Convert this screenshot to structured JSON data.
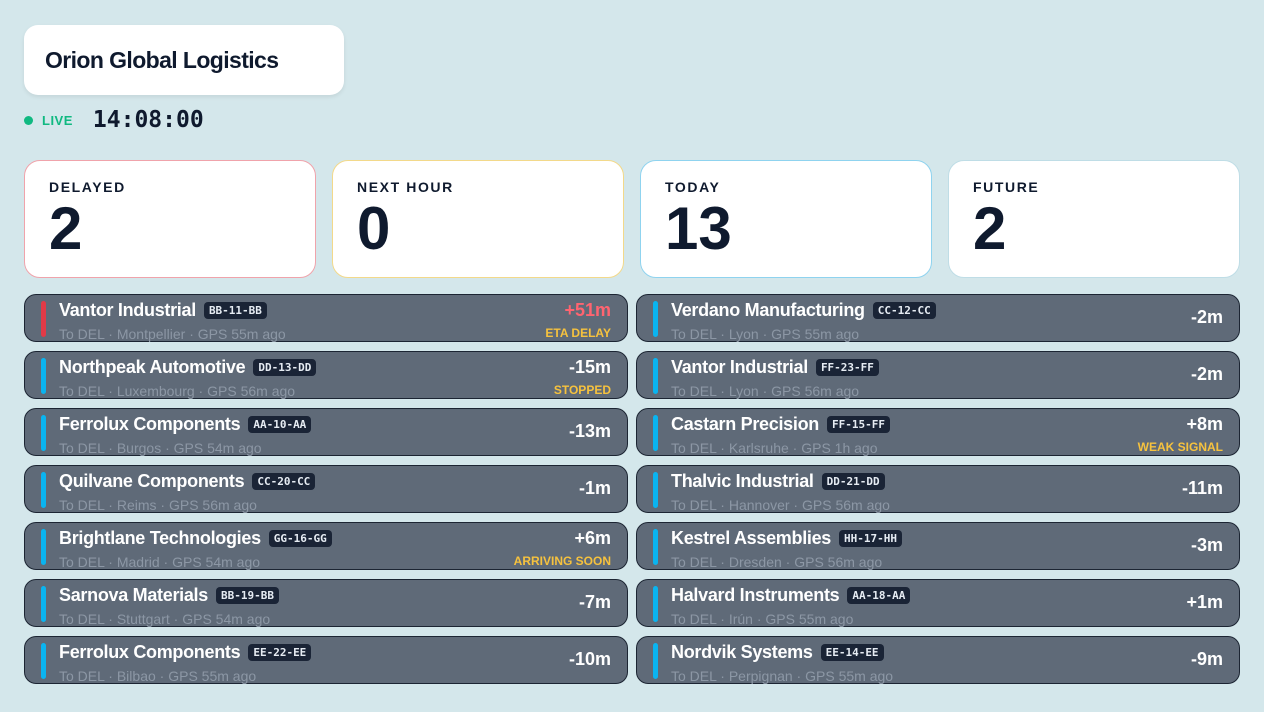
{
  "header": {
    "title": "Orion Global Logistics",
    "live_label": "LIVE",
    "clock": "14:08:00"
  },
  "stats": [
    {
      "label": "DELAYED",
      "value": "2",
      "border_color": "#f0a3ab"
    },
    {
      "label": "NEXT HOUR",
      "value": "0",
      "border_color": "#f3d98a"
    },
    {
      "label": "TODAY",
      "value": "13",
      "border_color": "#8fd3ef"
    },
    {
      "label": "FUTURE",
      "value": "2",
      "border_color": "#bfdde6"
    }
  ],
  "colors": {
    "background": "#d4e7eb",
    "row_bg": "#5f6a78",
    "accent_blue": "#0ab4f0",
    "accent_red": "#e23a47",
    "status_yellow": "#f6c23e",
    "live_green": "#10b981"
  },
  "columns": [
    [
      {
        "name": "Vantor Industrial",
        "code": "BB-11-BB",
        "dest": "To DEL",
        "city": "Montpellier",
        "gps": "GPS 55m ago",
        "delay": "+51m",
        "status": "ETA DELAY",
        "alert": true
      },
      {
        "name": "Northpeak Automotive",
        "code": "DD-13-DD",
        "dest": "To DEL",
        "city": "Luxembourg",
        "gps": "GPS 56m ago",
        "delay": "-15m",
        "status": "STOPPED",
        "alert": false
      },
      {
        "name": "Ferrolux Components",
        "code": "AA-10-AA",
        "dest": "To DEL",
        "city": "Burgos",
        "gps": "GPS 54m ago",
        "delay": "-13m",
        "status": "",
        "alert": false
      },
      {
        "name": "Quilvane Components",
        "code": "CC-20-CC",
        "dest": "To DEL",
        "city": "Reims",
        "gps": "GPS 56m ago",
        "delay": "-1m",
        "status": "",
        "alert": false
      },
      {
        "name": "Brightlane Technologies",
        "code": "GG-16-GG",
        "dest": "To DEL",
        "city": "Madrid",
        "gps": "GPS 54m ago",
        "delay": "+6m",
        "status": "ARRIVING SOON",
        "alert": false
      },
      {
        "name": "Sarnova Materials",
        "code": "BB-19-BB",
        "dest": "To DEL",
        "city": "Stuttgart",
        "gps": "GPS 54m ago",
        "delay": "-7m",
        "status": "",
        "alert": false
      },
      {
        "name": "Ferrolux Components",
        "code": "EE-22-EE",
        "dest": "To DEL",
        "city": "Bilbao",
        "gps": "GPS 55m ago",
        "delay": "-10m",
        "status": "",
        "alert": false
      }
    ],
    [
      {
        "name": "Verdano Manufacturing",
        "code": "CC-12-CC",
        "dest": "To DEL",
        "city": "Lyon",
        "gps": "GPS 55m ago",
        "delay": "-2m",
        "status": "",
        "alert": false
      },
      {
        "name": "Vantor Industrial",
        "code": "FF-23-FF",
        "dest": "To DEL",
        "city": "Lyon",
        "gps": "GPS 56m ago",
        "delay": "-2m",
        "status": "",
        "alert": false
      },
      {
        "name": "Castarn Precision",
        "code": "FF-15-FF",
        "dest": "To DEL",
        "city": "Karlsruhe",
        "gps": "GPS 1h ago",
        "delay": "+8m",
        "status": "WEAK SIGNAL",
        "alert": false
      },
      {
        "name": "Thalvic Industrial",
        "code": "DD-21-DD",
        "dest": "To DEL",
        "city": "Hannover",
        "gps": "GPS 56m ago",
        "delay": "-11m",
        "status": "",
        "alert": false
      },
      {
        "name": "Kestrel Assemblies",
        "code": "HH-17-HH",
        "dest": "To DEL",
        "city": "Dresden",
        "gps": "GPS 56m ago",
        "delay": "-3m",
        "status": "",
        "alert": false
      },
      {
        "name": "Halvard Instruments",
        "code": "AA-18-AA",
        "dest": "To DEL",
        "city": "Irún",
        "gps": "GPS 55m ago",
        "delay": "+1m",
        "status": "",
        "alert": false
      },
      {
        "name": "Nordvik Systems",
        "code": "EE-14-EE",
        "dest": "To DEL",
        "city": "Perpignan",
        "gps": "GPS 55m ago",
        "delay": "-9m",
        "status": "",
        "alert": false
      }
    ]
  ]
}
